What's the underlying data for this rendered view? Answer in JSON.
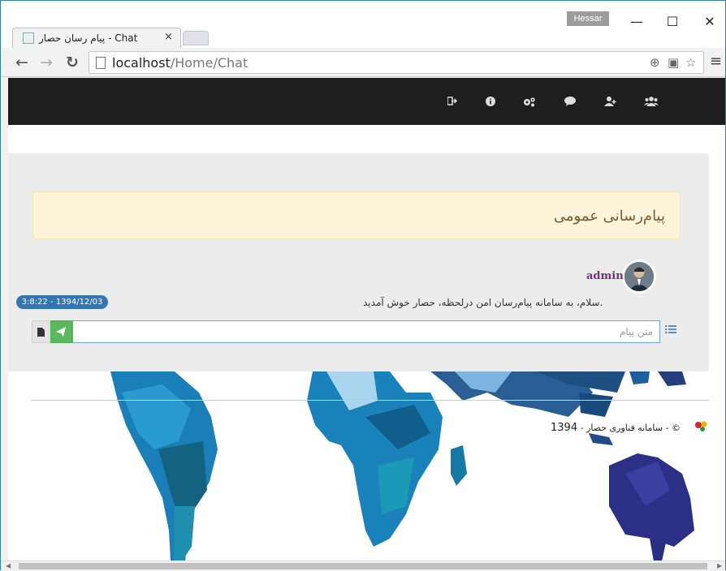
{
  "browser": {
    "profile": "Hessar",
    "tab_title": "پیام رسان حصار - Chat",
    "tab_close": "×",
    "url_host": "localhost",
    "url_path": "/Home/Chat",
    "window_min": "—",
    "window_max": "☐",
    "window_close": "✕"
  },
  "chat": {
    "panel_title": "پیام‌رسانی عمومی",
    "username": "admin",
    "message": "سلام، به سامانه پیام‌رسان امن درلحظه، حصار خوش آمدید.",
    "timestamp": "3:8:22 - 1394/12/03",
    "input_placeholder": "متن پیام"
  },
  "footer": {
    "year": "1394",
    "text": "سامانه فناوری حصار",
    "copyright": "©"
  },
  "colors": {
    "nav_bg": "#1e1e1e",
    "panel_bg": "#ececec",
    "title_bg": "#fcf5dc",
    "send_button": "#5cb85c",
    "timestamp_badge": "#3277b3",
    "username": "#7a2c7a"
  },
  "icons": [
    "sign-out-icon",
    "info-icon",
    "cogs-icon",
    "comment-icon",
    "add-user-icon",
    "users-icon",
    "file-icon",
    "send-icon",
    "list-icon"
  ]
}
